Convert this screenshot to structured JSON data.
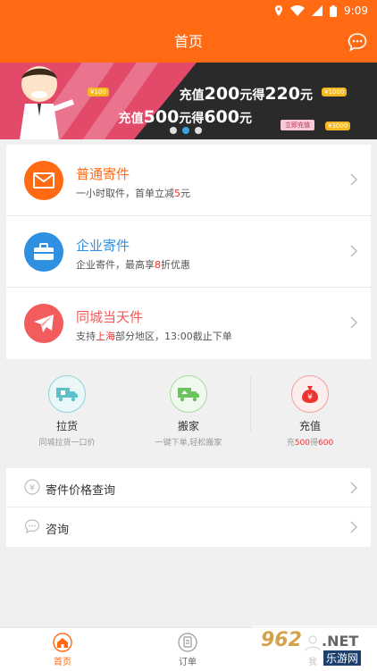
{
  "status": {
    "time": "9:09"
  },
  "header": {
    "title": "首页"
  },
  "banner": {
    "line1_prefix": "充值",
    "line1_amount": "200",
    "line1_mid": "元得",
    "line1_get": "220",
    "line1_suffix": "元",
    "line2_prefix": "充值",
    "line2_amount": "500",
    "line2_mid": "元得",
    "line2_get": "600",
    "line2_suffix": "元",
    "cta": "立即充值",
    "coin1": "¥3000",
    "coin2": "¥1000",
    "coin3": "¥100",
    "active_dot": 1
  },
  "services": [
    {
      "title": "普通寄件",
      "sub_a": "一小时取件，首单立减",
      "sub_hl": "5",
      "sub_b": "元",
      "color": "#ff6a13",
      "icon": "envelope-icon"
    },
    {
      "title": "企业寄件",
      "sub_a": "企业寄件，最高享",
      "sub_hl": "8",
      "sub_b": "折优惠",
      "color": "#2f8fe0",
      "icon": "briefcase-icon"
    },
    {
      "title": "同城当天件",
      "sub_a": "支持",
      "sub_hl": "上海",
      "sub_b": "部分地区，13:00截止下单",
      "color": "#f25c5c",
      "icon": "paper-plane-icon"
    }
  ],
  "quick": [
    {
      "label": "拉货",
      "sub_a": "同城拉货一口价",
      "sub_hl": "",
      "sub_b": ""
    },
    {
      "label": "搬家",
      "sub_a": "一键下单,轻松搬家",
      "sub_hl": "",
      "sub_b": ""
    },
    {
      "label": "充值",
      "sub_a": "充",
      "sub_hl": "500",
      "sub_b": "得",
      "sub_hl2": "600"
    }
  ],
  "links": [
    {
      "label": "寄件价格查询",
      "icon": "yen-circle-icon"
    },
    {
      "label": "咨询",
      "icon": "chat-bubble-icon"
    }
  ],
  "tabs": [
    {
      "label": "首页",
      "active": true,
      "icon": "home-icon"
    },
    {
      "label": "订单",
      "active": false,
      "icon": "order-icon"
    },
    {
      "label": "我",
      "active": false,
      "icon": "user-icon"
    }
  ],
  "watermark": {
    "brand": "962",
    "net": ".NET",
    "site": "乐游网"
  },
  "colors": {
    "accent": "#ff6a13",
    "blue": "#2f8fe0",
    "red": "#f25c5c"
  }
}
